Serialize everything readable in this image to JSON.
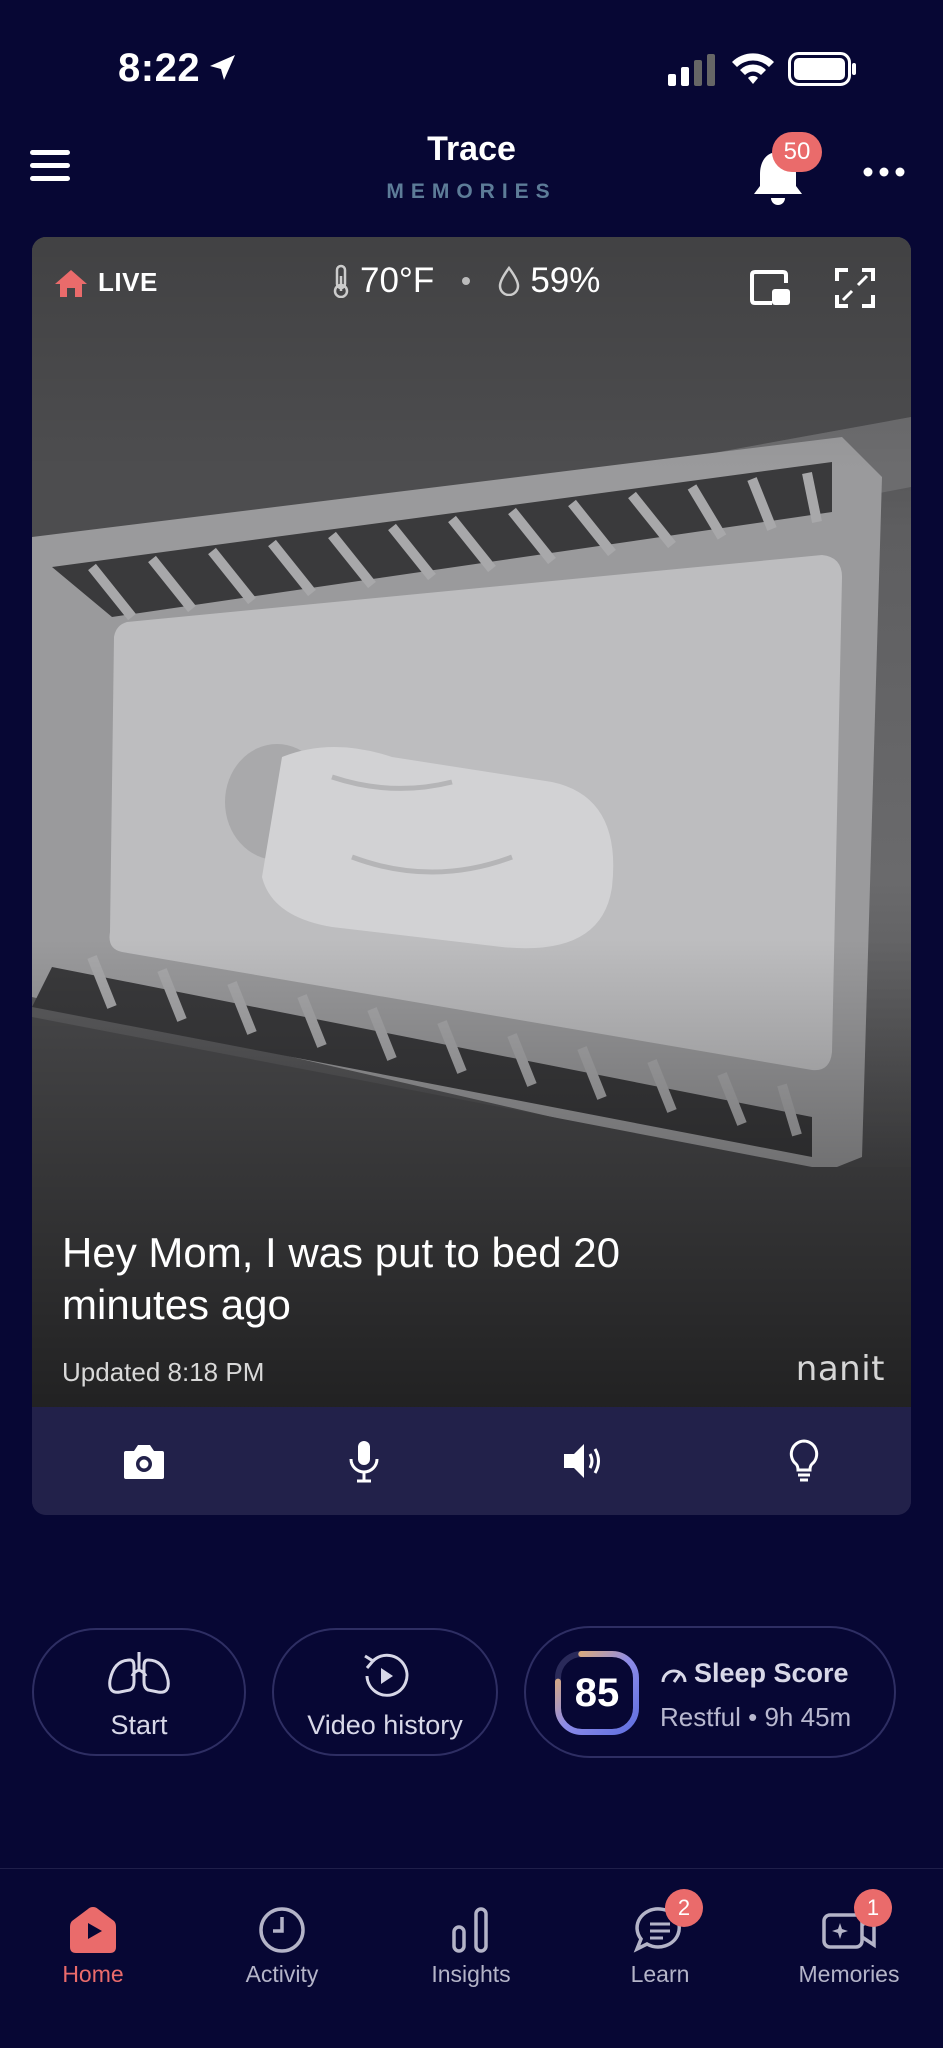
{
  "status_bar": {
    "time": "8:22"
  },
  "header": {
    "title": "Trace",
    "subtitle": "MEMORIES",
    "notifications_count": "50"
  },
  "video": {
    "live_label": "LIVE",
    "temperature": "70°F",
    "humidity": "59%",
    "message": "Hey Mom, I was put to bed 20 minutes ago",
    "updated": "Updated 8:18 PM",
    "brand": "nanit"
  },
  "controls": [
    "camera-icon",
    "microphone-icon",
    "speaker-icon",
    "lightbulb-icon"
  ],
  "actions": {
    "start_label": "Start",
    "history_label": "Video history",
    "sleep_score": {
      "value": "85",
      "title": "Sleep Score",
      "subtitle": "Restful • 9h 45m",
      "fraction": 0.85
    }
  },
  "tabs": [
    {
      "label": "Home",
      "icon": "home-icon",
      "active": true,
      "badge": ""
    },
    {
      "label": "Activity",
      "icon": "clock-icon",
      "active": false,
      "badge": ""
    },
    {
      "label": "Insights",
      "icon": "bar-chart-icon",
      "active": false,
      "badge": ""
    },
    {
      "label": "Learn",
      "icon": "chat-icon",
      "active": false,
      "badge": "2"
    },
    {
      "label": "Memories",
      "icon": "memories-icon",
      "active": false,
      "badge": "1"
    }
  ],
  "colors": {
    "background": "#070734",
    "accent": "#ea6b6b",
    "card": "#22214a",
    "subtitle": "#5d7c98"
  }
}
